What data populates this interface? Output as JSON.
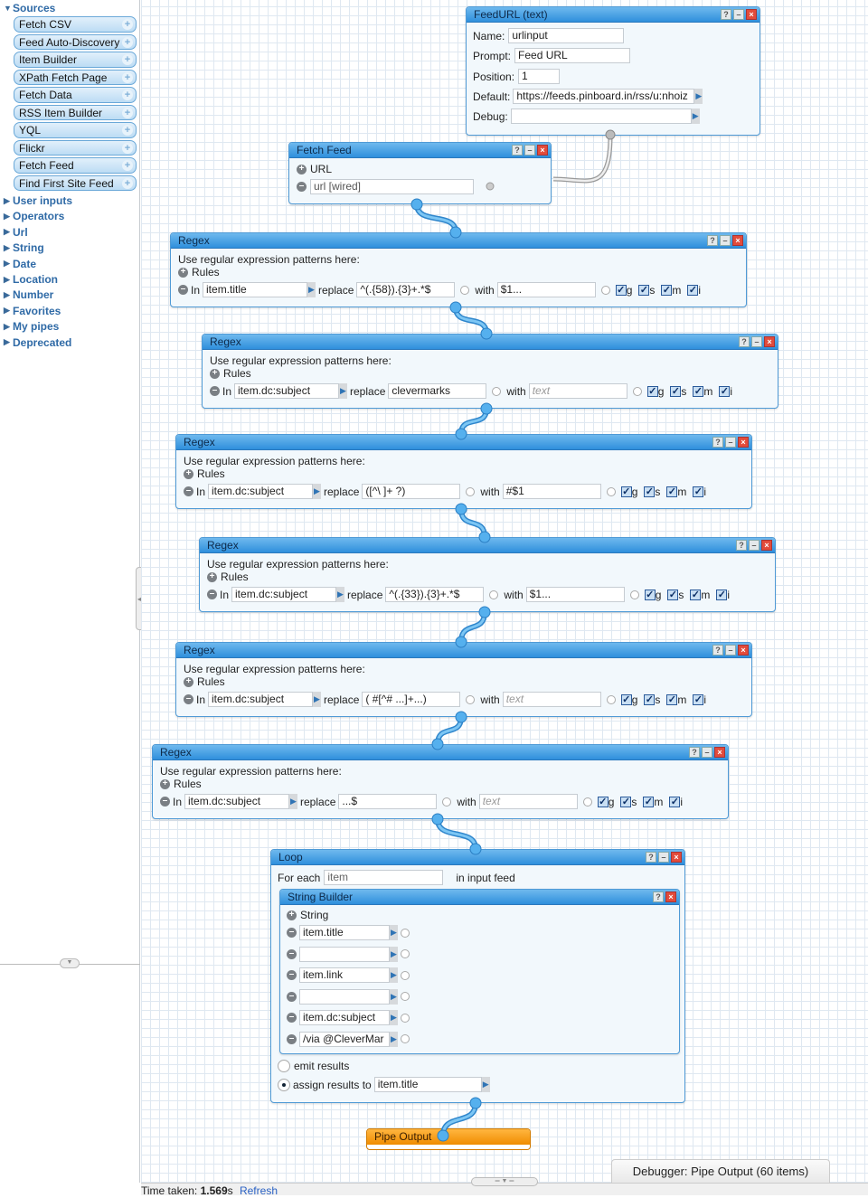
{
  "sidebar": {
    "sources_label": "Sources",
    "sources": [
      "Fetch CSV",
      "Feed Auto-Discovery",
      "Item Builder",
      "XPath Fetch Page",
      "Fetch Data",
      "RSS Item Builder",
      "YQL",
      "Flickr",
      "Fetch Feed",
      "Find First Site Feed"
    ],
    "categories": [
      "User inputs",
      "Operators",
      "Url",
      "String",
      "Date",
      "Location",
      "Number",
      "Favorites",
      "My pipes",
      "Deprecated"
    ]
  },
  "feedurl": {
    "title": "FeedURL (text)",
    "name_label": "Name:",
    "name_value": "urlinput",
    "prompt_label": "Prompt:",
    "prompt_value": "Feed URL",
    "position_label": "Position:",
    "position_value": "1",
    "default_label": "Default:",
    "default_value": "https://feeds.pinboard.in/rss/u:nhoiz",
    "debug_label": "Debug:",
    "debug_value": ""
  },
  "fetchfeed": {
    "title": "Fetch Feed",
    "url_label": "URL",
    "url_value": "url [wired]"
  },
  "regex_common": {
    "title": "Regex",
    "intro": "Use regular expression patterns here:",
    "rules": "Rules",
    "in": "In",
    "replace": "replace",
    "with": "with",
    "flags": [
      "g",
      "s",
      "m",
      "i"
    ]
  },
  "regexes": [
    {
      "in": "item.title",
      "replace": "^(.{58}).{3}+.*$",
      "with": "$1...",
      "with_placeholder": false
    },
    {
      "in": "item.dc:subject",
      "replace": "clevermarks",
      "with": "text",
      "with_placeholder": true
    },
    {
      "in": "item.dc:subject",
      "replace": "([^\\ ]+ ?)",
      "with": "#$1",
      "with_placeholder": false
    },
    {
      "in": "item.dc:subject",
      "replace": "^(.{33}).{3}+.*$",
      "with": "$1...",
      "with_placeholder": false
    },
    {
      "in": "item.dc:subject",
      "replace": "( #[^# ...]+...)",
      "with": "text",
      "with_placeholder": true
    },
    {
      "in": "item.dc:subject",
      "replace": "...$",
      "with": "text",
      "with_placeholder": true
    }
  ],
  "loop": {
    "title": "Loop",
    "for_each": "For each",
    "item_value": "item",
    "in_input_feed": "in input feed",
    "emit_results": "emit results",
    "assign_results": "assign results to",
    "assign_value": "item.title",
    "selected_mode": "assign"
  },
  "string_builder": {
    "title": "String Builder",
    "string_label": "String",
    "parts": [
      "item.title",
      "",
      "item.link",
      "",
      "item.dc:subject",
      " /via @CleverMar"
    ]
  },
  "pipe_output": {
    "title": "Pipe Output"
  },
  "debugger": {
    "tab_label": "Debugger: Pipe Output (60 items)"
  },
  "status": {
    "time_label": "Time taken:",
    "time_value": "1.569",
    "time_unit": "s",
    "refresh": "Refresh"
  },
  "colors": {
    "module_header": "#3b95de",
    "wire": "#4aa8e8",
    "output": "#f39a10"
  }
}
